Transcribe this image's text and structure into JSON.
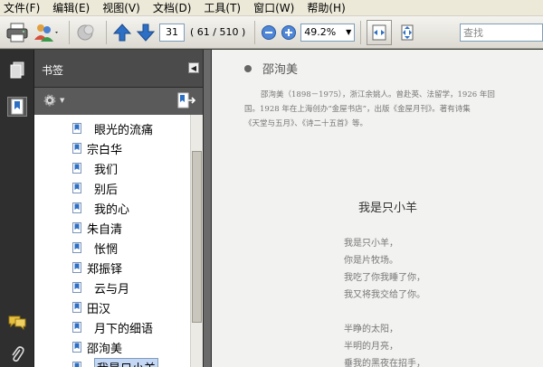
{
  "menu": [
    "文件(F)",
    "编辑(E)",
    "视图(V)",
    "文档(D)",
    "工具(T)",
    "窗口(W)",
    "帮助(H)"
  ],
  "toolbar": {
    "current_page": "31",
    "page_info": "( 61 / 510 )",
    "zoom": "49.2%",
    "search_placeholder": "查找"
  },
  "panel": {
    "title": "书签"
  },
  "bookmarks": [
    {
      "text": "眼光的流痛",
      "level": 2
    },
    {
      "text": "宗白华",
      "level": 1
    },
    {
      "text": "我们",
      "level": 2
    },
    {
      "text": "别后",
      "level": 2
    },
    {
      "text": "我的心",
      "level": 2
    },
    {
      "text": "朱自清",
      "level": 1
    },
    {
      "text": "怅惘",
      "level": 2
    },
    {
      "text": "郑振铎",
      "level": 1
    },
    {
      "text": "云与月",
      "level": 2
    },
    {
      "text": "田汉",
      "level": 1
    },
    {
      "text": "月下的细语",
      "level": 2
    },
    {
      "text": "邵洵美",
      "level": 1
    },
    {
      "text": "我是只小羊",
      "level": 2,
      "selected": true
    }
  ],
  "document": {
    "heading": "邵洵美",
    "bio_lines": [
      "邵洵美（1898－1975），浙江余姚人。曾赴英、法留学，1926 年回",
      "国。1928 年在上海创办“金屋书店”，出版《金屋月刊》。著有诗集",
      "《天堂与五月》、《诗二十五首》等。"
    ],
    "poem_title": "我是只小羊",
    "poem_lines": [
      "我是只小羊，",
      "你是片牧场。",
      "我吃了你我睡了你，",
      "我又将我交给了你。",
      "",
      "半睁的太阳，",
      "半明的月亮，",
      "垂我的黑夜在招手，"
    ]
  },
  "colors": {
    "menubar": "#ece9d8",
    "panel_header": "#4b4b4b",
    "selection": "#c4d7f5",
    "accent_blue": "#2d6fc4"
  }
}
